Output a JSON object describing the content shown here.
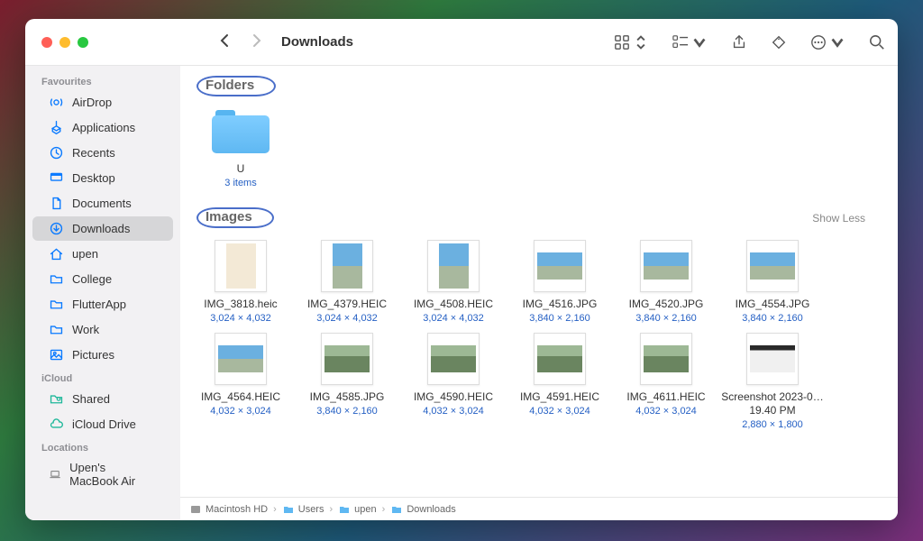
{
  "window": {
    "title": "Downloads"
  },
  "toolbar": {
    "show_less": "Show Less"
  },
  "sidebar": {
    "sections": [
      {
        "label": "Favourites",
        "items": [
          {
            "icon": "airdrop",
            "label": "AirDrop"
          },
          {
            "icon": "apps",
            "label": "Applications"
          },
          {
            "icon": "recents",
            "label": "Recents"
          },
          {
            "icon": "desktop",
            "label": "Desktop"
          },
          {
            "icon": "doc",
            "label": "Documents"
          },
          {
            "icon": "downloads",
            "label": "Downloads",
            "active": true
          },
          {
            "icon": "home",
            "label": "upen"
          },
          {
            "icon": "folder",
            "label": "College"
          },
          {
            "icon": "folder",
            "label": "FlutterApp"
          },
          {
            "icon": "folder",
            "label": "Work"
          },
          {
            "icon": "pictures",
            "label": "Pictures"
          }
        ]
      },
      {
        "label": "iCloud",
        "items": [
          {
            "icon": "shared",
            "label": "Shared"
          },
          {
            "icon": "icloud",
            "label": "iCloud Drive"
          }
        ]
      },
      {
        "label": "Locations",
        "items": [
          {
            "icon": "laptop",
            "label": "Upen's MacBook Air",
            "loc": true
          }
        ]
      }
    ]
  },
  "groups": [
    {
      "name": "Folders",
      "highlight": true,
      "items": [
        {
          "kind": "folder",
          "name": "U",
          "sub": "3 items"
        }
      ]
    },
    {
      "name": "Images",
      "highlight": true,
      "show_less": true,
      "items": [
        {
          "kind": "img",
          "shape": "portrait",
          "style": "doc",
          "name": "IMG_3818.heic",
          "sub": "3,024 × 4,032"
        },
        {
          "kind": "img",
          "shape": "portrait",
          "style": "mountain",
          "name": "IMG_4379.HEIC",
          "sub": "3,024 × 4,032"
        },
        {
          "kind": "img",
          "shape": "portrait",
          "style": "mountain",
          "name": "IMG_4508.HEIC",
          "sub": "3,024 × 4,032"
        },
        {
          "kind": "img",
          "shape": "landscape",
          "style": "mountain",
          "name": "IMG_4516.JPG",
          "sub": "3,840 × 2,160"
        },
        {
          "kind": "img",
          "shape": "landscape",
          "style": "mountain",
          "name": "IMG_4520.JPG",
          "sub": "3,840 × 2,160"
        },
        {
          "kind": "img",
          "shape": "landscape",
          "style": "mountain",
          "name": "IMG_4554.JPG",
          "sub": "3,840 × 2,160"
        },
        {
          "kind": "img",
          "shape": "landscape",
          "style": "mountain",
          "name": "IMG_4564.HEIC",
          "sub": "4,032 × 3,024"
        },
        {
          "kind": "img",
          "shape": "landscape",
          "style": "valley",
          "name": "IMG_4585.JPG",
          "sub": "3,840 × 2,160"
        },
        {
          "kind": "img",
          "shape": "landscape",
          "style": "valley",
          "name": "IMG_4590.HEIC",
          "sub": "4,032 × 3,024"
        },
        {
          "kind": "img",
          "shape": "landscape",
          "style": "valley",
          "name": "IMG_4591.HEIC",
          "sub": "4,032 × 3,024"
        },
        {
          "kind": "img",
          "shape": "landscape",
          "style": "valley",
          "name": "IMG_4611.HEIC",
          "sub": "4,032 × 3,024"
        },
        {
          "kind": "img",
          "shape": "landscape",
          "style": "screenshot",
          "name": "Screenshot 2023-0…19.40 PM",
          "sub": "2,880 × 1,800"
        }
      ]
    }
  ],
  "pathbar": [
    "Macintosh HD",
    "Users",
    "upen",
    "Downloads"
  ]
}
